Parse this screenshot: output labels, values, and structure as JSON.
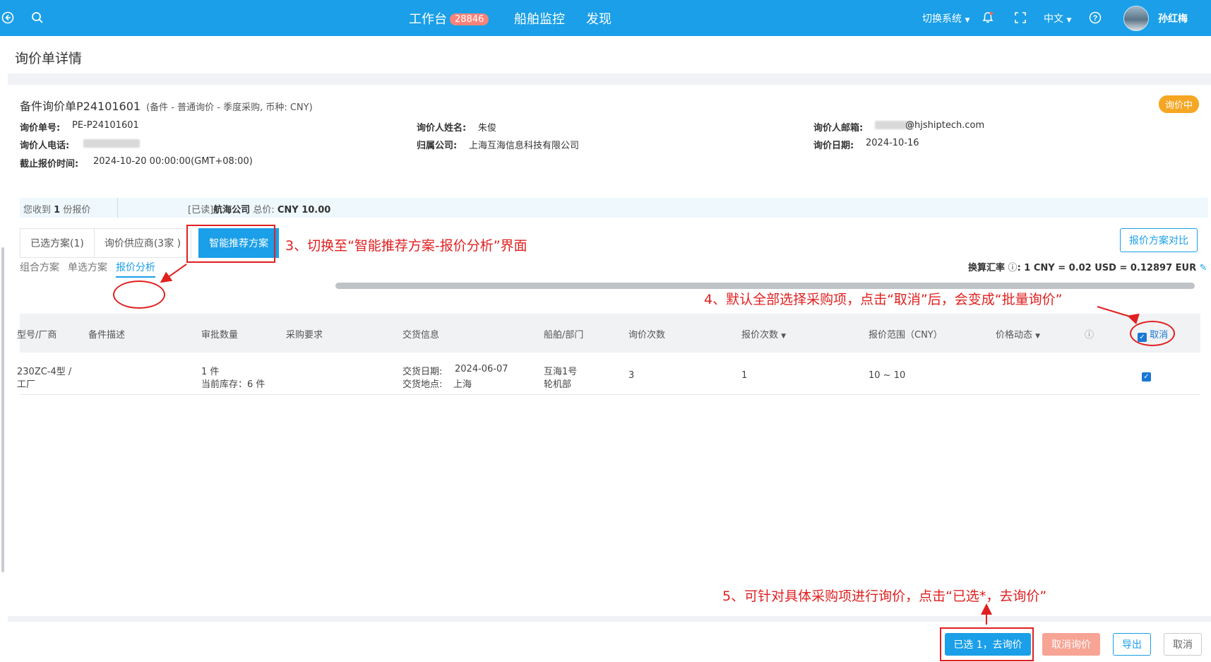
{
  "topbar": {
    "nav": {
      "workbench": "工作台",
      "workbench_badge": "28846",
      "ship_monitor": "船舶监控",
      "discover": "发现"
    },
    "switch_system": "切换系统",
    "language": "中文",
    "user_name": "孙红梅"
  },
  "page": {
    "title": "询价单详情"
  },
  "sheet": {
    "title": "备件询价单P24101601",
    "subtitle": "(备件 - 普通询价 - 季度采购, 币种: CNY)",
    "status": "询价中",
    "fields": {
      "order_no_label": "询价单号:",
      "order_no": "PE-P24101601",
      "contact_name_label": "询价人姓名:",
      "contact_name": "朱俊",
      "email_label": "询价人邮箱:",
      "email_suffix": "@hjshiptech.com",
      "phone_label": "询价人电话:",
      "company_label": "归属公司:",
      "company": "上海互海信息科技有限公司",
      "date_label": "询价日期:",
      "date": "2024-10-16",
      "deadline_label": "截止报价时间:",
      "deadline": "2024-10-20 00:00:00(GMT+08:00)"
    }
  },
  "quotes_bar": {
    "received_prefix": "您收到",
    "received_count": "1",
    "received_suffix": "份报价",
    "read_tag": "[已读]",
    "supplier": "航海公司",
    "total_label": "总价:",
    "total_value": "CNY  10.00"
  },
  "tabs": {
    "selected": "已选方案(1)",
    "suppliers": "询价供应商(3家 )",
    "smart": "智能推荐方案"
  },
  "compare_button": "报价方案对比",
  "rate": {
    "label": "换算汇率",
    "value": "1 CNY = 0.02 USD = 0.12897 EUR"
  },
  "subtabs": {
    "combo": "组合方案",
    "single": "单选方案",
    "analysis": "报价分析"
  },
  "table": {
    "headers": {
      "model": "型号/厂商",
      "desc": "备件描述",
      "approve_qty": "审批数量",
      "purchase_req": "采购要求",
      "delivery": "交货信息",
      "ship_dept": "船舶/部门",
      "inquiry_count": "询价次数",
      "quote_count": "报价次数",
      "quote_range": "报价范围（CNY）",
      "price_trend": "价格动态",
      "cancel": "取消"
    },
    "row": {
      "model_line1": "230ZC-4型 /",
      "model_line2": "工厂",
      "qty": "1 件",
      "stock": "当前库存：6 件",
      "delivery_date_label": "交货日期:",
      "delivery_date": "2024-06-07",
      "delivery_place_label": "交货地点:",
      "delivery_place": "上海",
      "ship": "互海1号",
      "dept": "轮机部",
      "inquiry_count": "3",
      "quote_count": "1",
      "quote_range": "10 ~ 10"
    }
  },
  "footer": {
    "go_inquiry": "已选 1，去询价",
    "cancel_inquiry": "取消询价",
    "export": "导出",
    "cancel": "取消"
  },
  "annotations": {
    "a3": "3、切换至“智能推荐方案-报价分析”界面",
    "a4": "4、默认全部选择采购项，点击“取消”后，会变成“批量询价”",
    "a5": "5、可针对具体采购项进行询价，点击“已选*，去询价”"
  },
  "colors": {
    "brand": "#1a9fe8",
    "badge": "#f9837a",
    "status": "#f5a623",
    "annotation": "#e02020",
    "cancel_inquiry": "#f7a495"
  }
}
